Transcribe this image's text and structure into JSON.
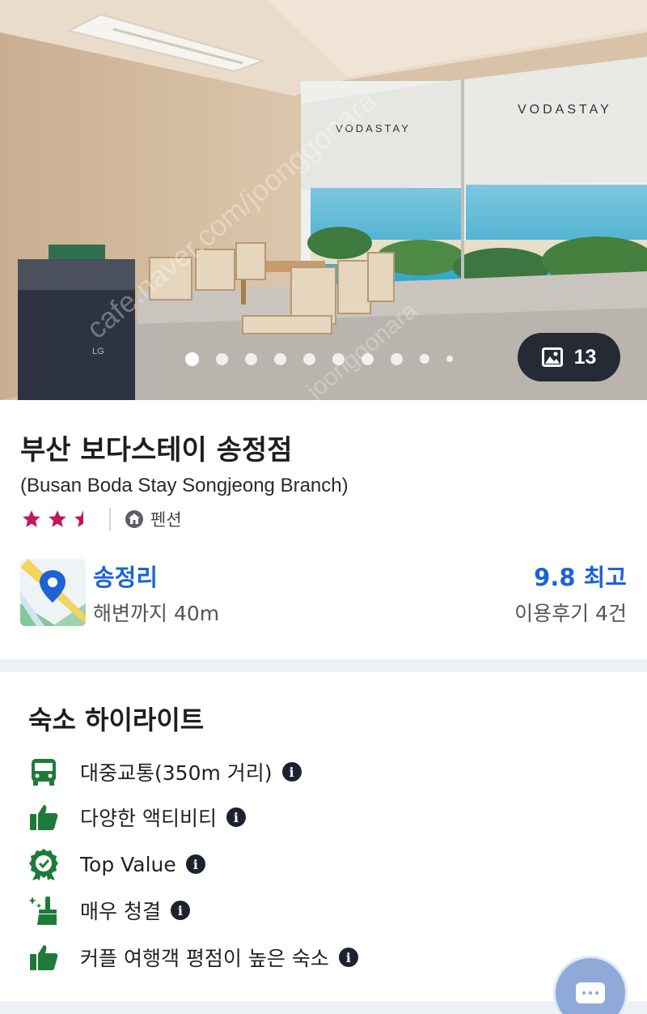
{
  "hero": {
    "brand_text_1": "VODASTAY",
    "brand_text_2": "VODASTAY",
    "watermark_1": "cafe.naver.com/joonggonara",
    "watermark_2": "joonggonara",
    "photo_count": "13",
    "carousel": {
      "total_dots": 10,
      "active_index": 0
    }
  },
  "property": {
    "name": "부산 보다스테이 송정점",
    "name_en": "(Busan Boda Stay Songjeong Branch)",
    "star_rating": 2.5,
    "type_label": "펜션"
  },
  "location": {
    "area": "송정리",
    "distance": "해변까지 40m"
  },
  "review": {
    "score_label": "9.8 최고",
    "count_label": "이용후기 4건"
  },
  "highlights": {
    "title": "숙소 하이라이트",
    "items": [
      {
        "icon": "bus-icon",
        "label": "대중교통(350m 거리)"
      },
      {
        "icon": "thumbs-up-icon",
        "label": "다양한 액티비티"
      },
      {
        "icon": "award-badge-icon",
        "label": "Top Value"
      },
      {
        "icon": "cleaning-broom-icon",
        "label": "매우 청결"
      },
      {
        "icon": "thumbs-up-icon",
        "label": "커플 여행객 평점이 높은 숙소"
      }
    ]
  },
  "colors": {
    "accent_blue": "#1d63d3",
    "star_pink": "#c2185b",
    "icon_green": "#1f7a3a",
    "divider": "#edf0f5"
  }
}
